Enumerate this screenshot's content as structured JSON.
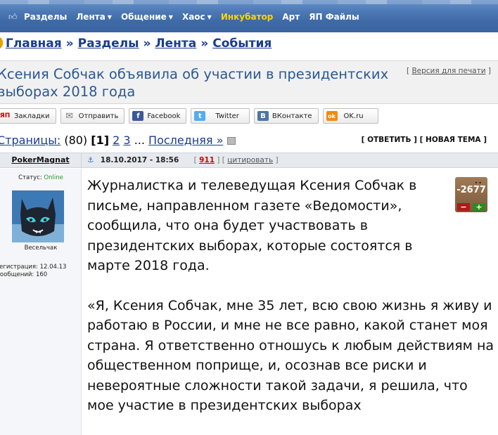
{
  "nav": {
    "items": [
      {
        "label": "Разделы",
        "arrow": false,
        "highlight": false
      },
      {
        "label": "Лента",
        "arrow": true,
        "highlight": false
      },
      {
        "label": "Общение",
        "arrow": true,
        "highlight": false
      },
      {
        "label": "Хаос",
        "arrow": true,
        "highlight": false
      },
      {
        "label": "Инкубатор",
        "arrow": false,
        "highlight": true
      },
      {
        "label": "Арт",
        "arrow": false,
        "highlight": false
      },
      {
        "label": "ЯП Файлы",
        "arrow": false,
        "highlight": false
      }
    ],
    "icon": "thumbs-up-icon",
    "highlight_color": "#ffd400"
  },
  "breadcrumb": {
    "items": [
      "Главная",
      "Разделы",
      "Лента",
      "События"
    ],
    "separator": "»"
  },
  "topic": {
    "title": "Ксения Собчак объявила об участии в президентских выборах 2018 года",
    "print_open": "[",
    "print_label": "Версия для печати",
    "print_close": "]"
  },
  "share": [
    {
      "label": "Закладки",
      "icon": "yap-icon",
      "icon_text": "ЯП",
      "color": "#ffffff"
    },
    {
      "label": "Отправить",
      "icon": "envelope-icon",
      "icon_text": "✉",
      "color": "#ffffff"
    },
    {
      "label": "Facebook",
      "icon": "facebook-icon",
      "icon_text": "f",
      "color": "#3b5998"
    },
    {
      "label": "Twitter",
      "icon": "twitter-icon",
      "icon_text": "t",
      "color": "#55acee"
    },
    {
      "label": "ВКонтакте",
      "icon": "vk-icon",
      "icon_text": "B",
      "color": "#4c75a3"
    },
    {
      "label": "OK.ru",
      "icon": "ok-icon",
      "icon_text": "ok",
      "color": "#f28a0f"
    }
  ],
  "pages": {
    "label": "Страницы:",
    "count": "(80)",
    "current": "[1]",
    "links": [
      "2",
      "3"
    ],
    "ellipsis": "...",
    "last": "Последняя »"
  },
  "actions": {
    "reply": "[ ОТВЕТИТЬ ]",
    "new_topic": "[ НОВАЯ ТЕМА ]"
  },
  "post": {
    "author": "PokerMagnat",
    "date": "18.10.2017 - 18:56",
    "number": "911",
    "quote": "цитировать",
    "status_label": "Статус:",
    "status_value": "Online",
    "rank": "Весельчак",
    "registration": "Регистрация: 12.04.13",
    "messages": "Сообщений: 160",
    "rating": "-2677",
    "rating_minus": "−",
    "rating_plus": "+",
    "paragraphs": [
      "Журналистка и телеведущая Ксения Собчак в письме, направленном газете «Ведомости», сообщила, что она будет участвовать в президентских выборах, которые состоятся в марте 2018 года.",
      "«Я, Ксения Собчак, мне 35 лет, всю свою жизнь я живу и работаю в России, и мне не все равно, какой станет моя страна. Я ответственно отношусь к любым действиям на общественном поприще, и, осознав все риски и невероятные сложности такой задачи, я решила, что мое участие в президентских выборах"
    ]
  }
}
